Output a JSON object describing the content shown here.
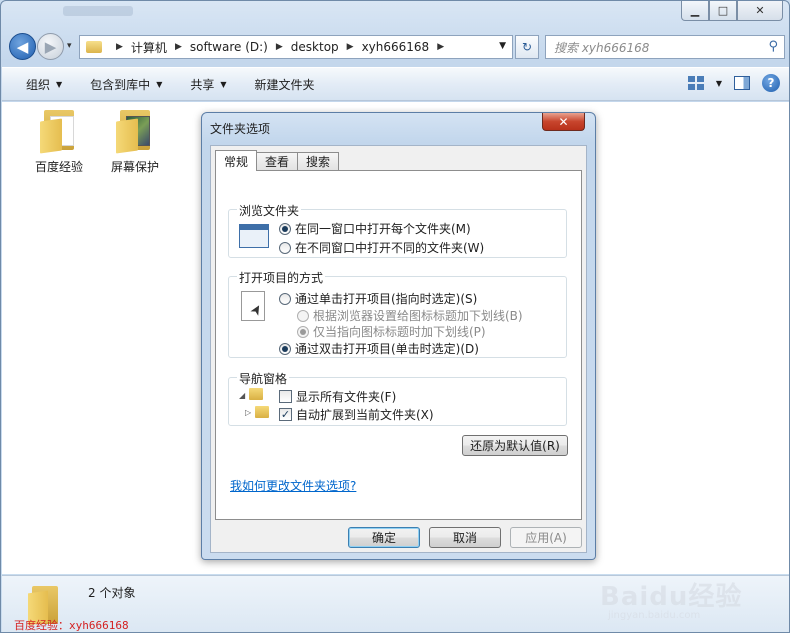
{
  "window": {
    "caption": {
      "minimize": "▁",
      "maximize": "□",
      "close": "✕"
    }
  },
  "nav": {
    "back_glyph": "◀",
    "forward_glyph": "▶",
    "history_glyph": "▾",
    "breadcrumb": [
      "计算机",
      "software (D:)",
      "desktop",
      "xyh666168"
    ],
    "crumb_separator": "▶",
    "dropdown_glyph": "▼",
    "refresh_glyph": "↻",
    "search_placeholder": "搜索 xyh666168",
    "search_icon": "search-icon"
  },
  "toolbar": {
    "organize": "组织",
    "include_in_library": "包含到库中",
    "share": "共享",
    "new_folder": "新建文件夹",
    "dropdown_arrow": "▼",
    "help": "?"
  },
  "files": [
    {
      "name": "百度经验",
      "icon": "folder-documents-icon"
    },
    {
      "name": "屏幕保护",
      "icon": "folder-pictures-icon"
    }
  ],
  "status": {
    "count": "2 个对象",
    "watermark_text": "百度经验：xyh666168",
    "baidu_logo": "Baidu经验",
    "baidu_url": "jingyan.baidu.com"
  },
  "dialog": {
    "title": "文件夹选项",
    "close": "✕",
    "tabs": [
      "常规",
      "查看",
      "搜索"
    ],
    "browse": {
      "title": "浏览文件夹",
      "same_window": "在同一窗口中打开每个文件夹(M)",
      "new_window": "在不同窗口中打开不同的文件夹(W)"
    },
    "open_items": {
      "title": "打开项目的方式",
      "single_click": "通过单击打开项目(指向时选定)(S)",
      "underline_browser": "根据浏览器设置给图标标题加下划线(B)",
      "underline_point": "仅当指向图标标题时加下划线(P)",
      "double_click": "通过双击打开项目(单击时选定)(D)"
    },
    "nav_pane": {
      "title": "导航窗格",
      "show_all": "显示所有文件夹(F)",
      "auto_expand": "自动扩展到当前文件夹(X)",
      "checkmark": "✓",
      "expanded_glyph": "◢",
      "collapsed_glyph": "▷"
    },
    "restore_defaults": "还原为默认值(R)",
    "help_link": "我如何更改文件夹选项?",
    "ok": "确定",
    "cancel": "取消",
    "apply": "应用(A)"
  }
}
